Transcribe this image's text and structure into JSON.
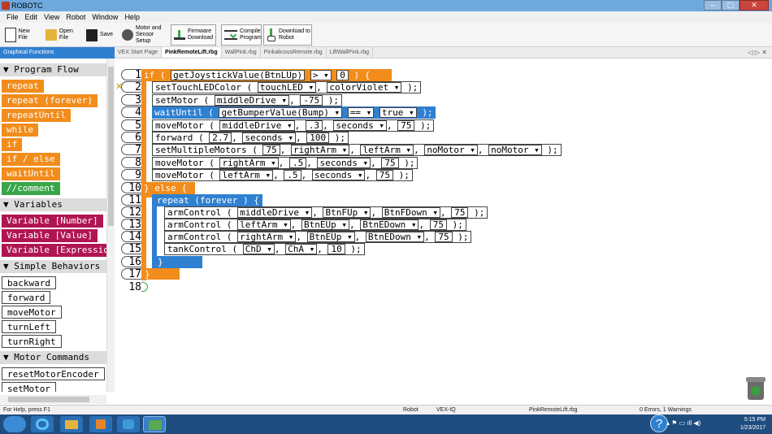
{
  "window": {
    "title": "ROBOTC",
    "controls": [
      "–",
      "▢",
      "✕"
    ]
  },
  "menu": [
    "File",
    "Edit",
    "View",
    "Robot",
    "Window",
    "Help"
  ],
  "toolbar": {
    "new_file": "New File",
    "open_file": "Open File",
    "save": "Save",
    "motor_sensor": "Motor and Sensor Setup",
    "firmware": "Firmware Download",
    "compile": "Compile Program",
    "download": "Download to Robot"
  },
  "palette": {
    "header": "Graphical Functions",
    "program_flow": "▼ Program Flow",
    "flow_items": [
      "repeat",
      "repeat (forever)",
      "repeatUntil",
      "while",
      "if",
      "if / else",
      "waitUntil"
    ],
    "comment": "//comment",
    "variables": "▼ Variables",
    "variable_items": [
      "Variable [Number]",
      "Variable [Value]",
      "Variable [Expressio"
    ],
    "simple": "▼ Simple Behaviors",
    "simple_items": [
      "backward",
      "forward",
      "moveMotor",
      "turnLeft",
      "turnRight"
    ],
    "motor": "▼ Motor Commands",
    "motor_items": [
      "resetMotorEncoder",
      "setMotor"
    ]
  },
  "tabs": [
    "VEX Start Page",
    "PinkRemoteLift.rbg",
    "WallPink.rbg",
    "PinkalicousRemote.rbg",
    "LiftWallPink.rbg"
  ],
  "tab_arrows": "◁ ▷ ✕",
  "lines": [
    "1",
    "2",
    "3",
    "4",
    "5",
    "6",
    "7",
    "8",
    "9",
    "10",
    "11",
    "12",
    "13",
    "14",
    "15",
    "16",
    "17",
    "18"
  ],
  "code": {
    "l1": {
      "kw": "if (",
      "fn": "getJoystickValue(BtnLUp)",
      "op": ">",
      "val": "0",
      "end": ") {"
    },
    "l2": {
      "fn": "setTouchLEDColor (",
      "a": "touchLED",
      "b": "colorViolet",
      "end": ");"
    },
    "l3": {
      "fn": "setMotor (",
      "a": "middleDrive",
      "b": "-75",
      "end": ");"
    },
    "l4": {
      "kw": "waitUntil (",
      "a": "getBumperValue(Bump)",
      "op": "==",
      "b": "true",
      "end": ");"
    },
    "l5": {
      "fn": "moveMotor (",
      "a": "middleDrive",
      "b": ".3",
      "c": "seconds",
      "d": "75",
      "end": ");"
    },
    "l6": {
      "fn": "forward (",
      "a": "2.7",
      "b": "seconds",
      "c": "100",
      "end": ");"
    },
    "l7": {
      "fn": "setMultipleMotors (",
      "a": "75",
      "b": "rightArm",
      "c": "leftArm",
      "d": "noMotor",
      "e": "noMotor",
      "end": ");"
    },
    "l8": {
      "fn": "moveMotor (",
      "a": "rightArm",
      "b": ".5",
      "c": "seconds",
      "d": "75",
      "end": ");"
    },
    "l9": {
      "fn": "moveMotor (",
      "a": "leftArm",
      "b": ".5",
      "c": "seconds",
      "d": "75",
      "end": ");"
    },
    "l10": "} else {",
    "l11": "repeat (forever ) {",
    "l12": {
      "fn": "armControl (",
      "a": "middleDrive",
      "b": "BtnFUp",
      "c": "BtnFDown",
      "d": "75",
      "end": ");"
    },
    "l13": {
      "fn": "armControl (",
      "a": "leftArm",
      "b": "BtnEUp",
      "c": "BtnEDown",
      "d": "75",
      "end": ");"
    },
    "l14": {
      "fn": "armControl (",
      "a": "rightArm",
      "b": "BtnEUp",
      "c": "BtnEDown",
      "d": "75",
      "end": ");"
    },
    "l15": {
      "fn": "tankControl (",
      "a": "ChD",
      "b": "ChA",
      "c": "10",
      "end": ");"
    },
    "l16": "}",
    "l17": "}"
  },
  "statusbar": {
    "help": "For Help, press F1",
    "robot": "Robot",
    "platform": "VEX-IQ",
    "file": "PinkRemoteLift.rbg",
    "errors": "0 Errors, 1 Warnings"
  },
  "tray": {
    "time": "5:15 PM",
    "date": "1/23/2017"
  },
  "colors": {
    "orange": "#f28c1b",
    "blue": "#2f80d1",
    "green": "#3aa64a",
    "magenta": "#b01552"
  }
}
